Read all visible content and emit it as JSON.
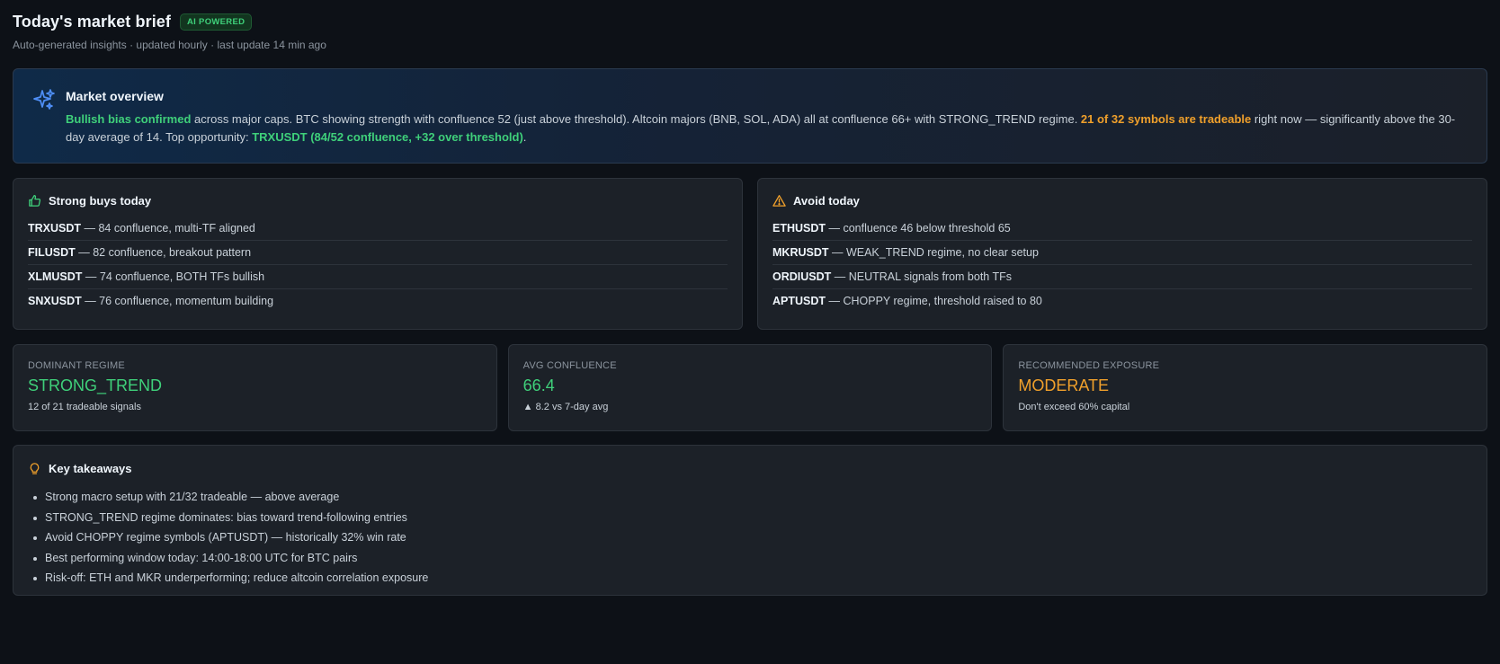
{
  "header": {
    "title": "Today's market brief",
    "badge": "AI POWERED",
    "subtitle": "Auto-generated insights · updated hourly · last update 14 min ago"
  },
  "overview": {
    "title": "Market overview",
    "icon": "sparkles-icon",
    "seg1": "Bullish bias confirmed",
    "seg2": " across major caps. BTC showing strength with confluence 52 (just above threshold). Altcoin majors (BNB, SOL, ADA) all at confluence 66+ with STRONG_TREND regime. ",
    "seg3": "21 of 32 symbols are tradeable",
    "seg4": " right now — significantly above the 30-day average of 14. Top opportunity: ",
    "seg5": "TRXUSDT (84/52 confluence, +32 over threshold)",
    "seg6": "."
  },
  "buys": {
    "title": "Strong buys today",
    "icon": "thumbs-up-icon",
    "items": [
      {
        "symbol": "TRXUSDT",
        "text": " — 84 confluence, multi-TF aligned"
      },
      {
        "symbol": "FILUSDT",
        "text": " — 82 confluence, breakout pattern"
      },
      {
        "symbol": "XLMUSDT",
        "text": " — 74 confluence, BOTH TFs bullish"
      },
      {
        "symbol": "SNXUSDT",
        "text": " — 76 confluence, momentum building"
      }
    ]
  },
  "avoid": {
    "title": "Avoid today",
    "icon": "warning-icon",
    "items": [
      {
        "symbol": "ETHUSDT",
        "text": " — confluence 46 below threshold 65"
      },
      {
        "symbol": "MKRUSDT",
        "text": " — WEAK_TREND regime, no clear setup"
      },
      {
        "symbol": "ORDIUSDT",
        "text": " — NEUTRAL signals from both TFs"
      },
      {
        "symbol": "APTUSDT",
        "text": " — CHOPPY regime, threshold raised to 80"
      }
    ]
  },
  "stats": [
    {
      "label": "DOMINANT REGIME",
      "value": "STRONG_TREND",
      "note": "12 of 21 tradeable signals",
      "color": "#3fd07a"
    },
    {
      "label": "AVG CONFLUENCE",
      "value": "66.4",
      "note": "▲ 8.2 vs 7-day avg",
      "color": "#3fd07a"
    },
    {
      "label": "RECOMMENDED EXPOSURE",
      "value": "MODERATE",
      "note": "Don't exceed 60% capital",
      "color": "#f0a02b"
    }
  ],
  "takeaways": {
    "title": "Key takeaways",
    "icon": "lightbulb-icon",
    "items": [
      "Strong macro setup with 21/32 tradeable — above average",
      "STRONG_TREND regime dominates: bias toward trend-following entries",
      "Avoid CHOPPY regime symbols (APTUSDT) — historically 32% win rate",
      "Best performing window today: 14:00-18:00 UTC for BTC pairs",
      "Risk-off: ETH and MKR underperforming; reduce altcoin correlation exposure"
    ]
  },
  "colors": {
    "accent_green": "#3fd07a",
    "accent_orange": "#f0a02b",
    "accent_blue": "#4f8ff7",
    "background": "#0d1117",
    "card": "#1c2128"
  }
}
